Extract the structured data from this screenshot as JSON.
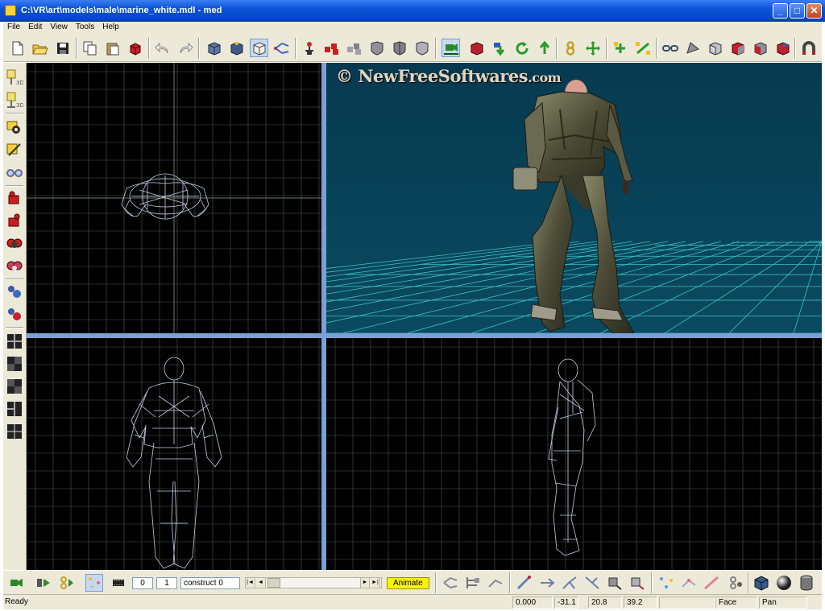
{
  "window": {
    "title": "C:\\VR\\art\\models\\male\\marine_white.mdl - med",
    "min_glyph": "_",
    "max_glyph": "□",
    "close_glyph": "✕"
  },
  "menu": [
    "File",
    "Edit",
    "View",
    "Tools",
    "Help"
  ],
  "toolbar_icons": [
    "new-file-icon",
    "open-folder-icon",
    "save-icon",
    "copy-icon",
    "paste-icon",
    "delete-icon",
    "undo-icon",
    "redo-icon",
    "cube-icon",
    "cube-wire-icon",
    "cube-selected-icon",
    "bones-icon",
    "hierarchy-icon",
    "red-cubes-icon",
    "cubes-icon",
    "shield-icon",
    "shield-alt-icon",
    "shield-outline-icon",
    "move-camera-icon",
    "red-box-icon",
    "down-arrow-icon",
    "rotate-icon",
    "up-arrow-icon",
    "number-8-icon",
    "move-cross-icon",
    "add-vertex-icon",
    "connect-icon",
    "link-icon",
    "triangle-icon",
    "box-face-icon",
    "box-red-icon",
    "box-red-alt-icon",
    "box-red-open-icon",
    "magnet-icon"
  ],
  "left_icons": [
    "top-3d-icon",
    "side-3d-icon",
    "eye-view-icon",
    "edit-pen-icon",
    "eye-glasses-icon",
    "red-hand-icon",
    "red-hand-alt-icon",
    "eye-red-icon",
    "eye-red-alt-icon",
    "blue-flask-icon",
    "red-flask-icon",
    "layout-quad-icon",
    "layout-split-icon",
    "layout-four-icon",
    "layout-three-icon",
    "layout-grid-icon"
  ],
  "bottom": {
    "frame_start": "0",
    "frame_end": "1",
    "sequence": "construct 0",
    "animate_label": "Animate"
  },
  "status": {
    "ready": "Ready",
    "x": "0.000",
    "y": "-31.1",
    "z": "20.8",
    "w": "39.2",
    "mode": "Face",
    "tool": "Pan"
  },
  "watermark": {
    "symbol": "©",
    "text": "NewFreeSoftwares",
    "suffix": ".com"
  },
  "colors": {
    "viewport_bg": "#000000",
    "perspective_bg": "#063c52",
    "grid": "#4a5a52",
    "wire": "#c4cce4",
    "floor_grid": "#3ac0c4"
  }
}
